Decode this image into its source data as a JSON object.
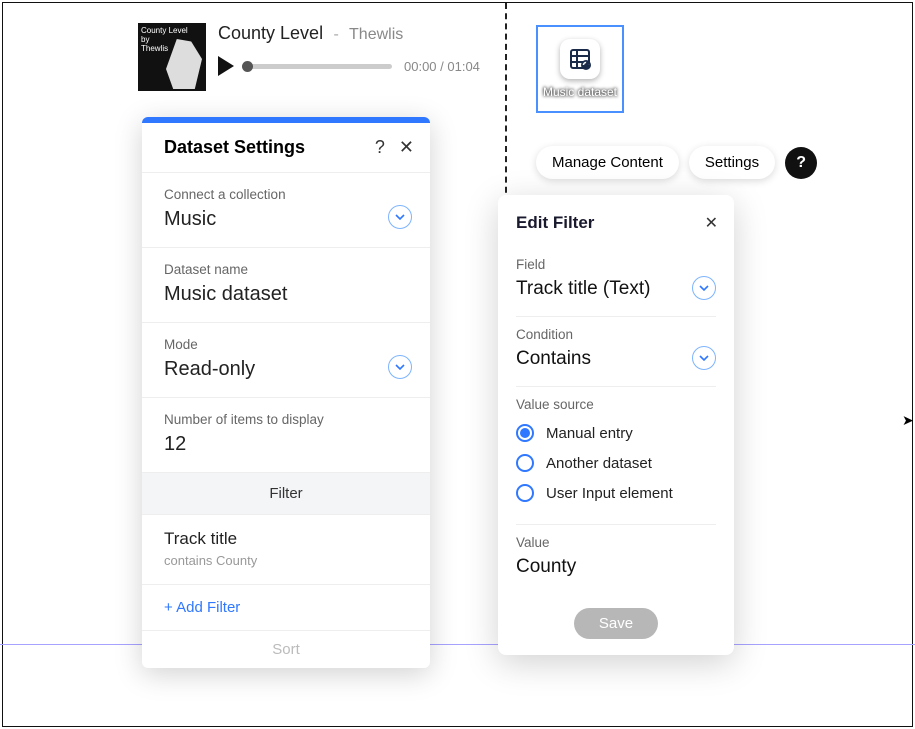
{
  "player": {
    "cover_line1": "County Level",
    "cover_line2": "by",
    "cover_line3": "Thewlis",
    "title": "County Level",
    "separator": "-",
    "artist": "Thewlis",
    "time": "00:00 / 01:04"
  },
  "dataset_element": {
    "label": "Music dataset"
  },
  "actions": {
    "manage": "Manage Content",
    "settings": "Settings",
    "help": "?"
  },
  "settings_panel": {
    "title": "Dataset Settings",
    "help": "?",
    "close": "✕",
    "connect": {
      "label": "Connect a collection",
      "value": "Music"
    },
    "name": {
      "label": "Dataset name",
      "value": "Music dataset"
    },
    "mode": {
      "label": "Mode",
      "value": "Read-only"
    },
    "count": {
      "label": "Number of items to display",
      "value": "12"
    },
    "filter_header": "Filter",
    "filter": {
      "field": "Track title",
      "summary": "contains County"
    },
    "add_filter": "+ Add Filter",
    "sort_hint": "Sort"
  },
  "edit_filter": {
    "title": "Edit Filter",
    "close": "✕",
    "field": {
      "label": "Field",
      "value": "Track title (Text)"
    },
    "condition": {
      "label": "Condition",
      "value": "Contains"
    },
    "source": {
      "label": "Value source",
      "options": [
        "Manual entry",
        "Another dataset",
        "User Input element"
      ],
      "selected": 0
    },
    "value": {
      "label": "Value",
      "value": "County"
    },
    "save": "Save"
  }
}
